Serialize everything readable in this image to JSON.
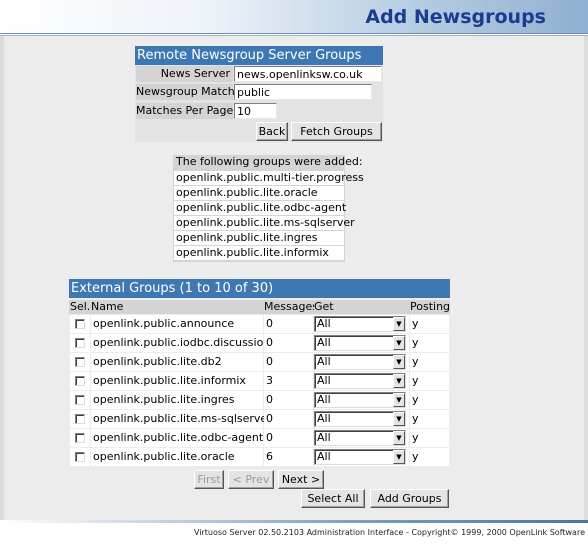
{
  "header": {
    "title": "Add Newsgroups"
  },
  "remote_panel": {
    "title": "Remote Newsgroup Server Groups",
    "fields": {
      "news_server_label": "News Server",
      "news_server_value": "news.openlinksw.co.uk",
      "match_label": "Newsgroup Match",
      "match_value": "public",
      "per_page_label": "Matches Per Page",
      "per_page_value": "10"
    },
    "back_button": "Back",
    "fetch_button": "Fetch Groups"
  },
  "added_groups": {
    "heading": "The following groups were added:",
    "items": [
      "openlink.public.multi-tier.progress",
      "openlink.public.lite.oracle",
      "openlink.public.lite.odbc-agent",
      "openlink.public.lite.ms-sqlserver",
      "openlink.public.lite.ingres",
      "openlink.public.lite.informix"
    ]
  },
  "external_groups": {
    "title": "External Groups (1 to 10 of 30)",
    "columns": [
      "Sel.",
      "Name",
      "Messages",
      "Get",
      "Posting"
    ],
    "rows": [
      {
        "name": "openlink.public.announce",
        "messages": "0",
        "get": "All",
        "posting": "y"
      },
      {
        "name": "openlink.public.iodbc.discussion",
        "messages": "0",
        "get": "All",
        "posting": "y"
      },
      {
        "name": "openlink.public.lite.db2",
        "messages": "0",
        "get": "All",
        "posting": "y"
      },
      {
        "name": "openlink.public.lite.informix",
        "messages": "3",
        "get": "All",
        "posting": "y"
      },
      {
        "name": "openlink.public.lite.ingres",
        "messages": "0",
        "get": "All",
        "posting": "y"
      },
      {
        "name": "openlink.public.lite.ms-sqlserver",
        "messages": "0",
        "get": "All",
        "posting": "y"
      },
      {
        "name": "openlink.public.lite.odbc-agent",
        "messages": "0",
        "get": "All",
        "posting": "y"
      },
      {
        "name": "openlink.public.lite.oracle",
        "messages": "6",
        "get": "All",
        "posting": "y"
      }
    ],
    "nav": {
      "first": "First",
      "prev": "< Prev",
      "next": "Next >"
    },
    "select_all_button": "Select All",
    "add_groups_button": "Add Groups"
  },
  "footer": {
    "text": "Virtuoso Server 02.50.2103 Administration Interface - Copyright© 1999, 2000 OpenLink Software"
  },
  "colors": {
    "panel_title_bg": "#3e78b3",
    "header_title": "#1a3d8f"
  }
}
